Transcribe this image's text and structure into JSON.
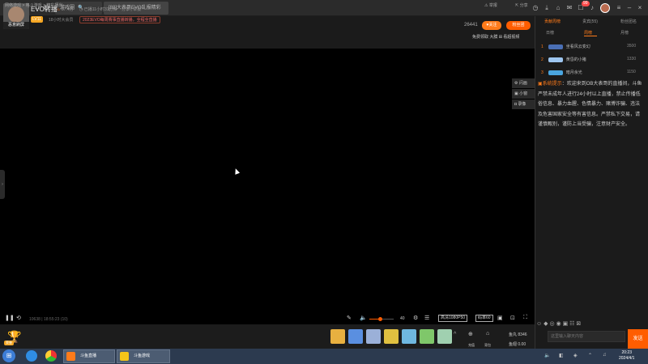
{
  "browser": {
    "logo": "斗鱼",
    "back": "←",
    "refresh": "C",
    "tabs": [
      {
        "label": "游戏圈",
        "close": ""
      },
      {
        "label": "[88]大表哥EVO乱报精彩",
        "close": "×"
      }
    ],
    "tab_search": "🔍"
  },
  "topbar_icons": [
    "clock-icon",
    "download-icon",
    "gift-icon",
    "mail-icon",
    "message-icon",
    "notification-icon",
    "menu-icon"
  ],
  "notifications": "99",
  "room": {
    "title": "EVO转播",
    "hot": "57.4万",
    "schedule": "已播11小时31分钟",
    "report": "分享 | 举报",
    "level": "LV11",
    "rank": "18小时大会员",
    "promo": "2023EVO每周赛事直播转播，全程全直播",
    "followers": "26441",
    "follow_label": "关注",
    "fan_label": "粉丝团",
    "sub_links": "免费领取  大膜  ⊞ 看超视频"
  },
  "anchor_caption": "恶意刷屏",
  "breadcrumb": "网络游戏 > 格斗游戏 > 精彩播出",
  "report_label": "举报",
  "share_label": "分享",
  "float_tools": [
    "闪画",
    "小窗",
    "录像"
  ],
  "controls": {
    "resolution": "高清1080P50",
    "bitrate": "码率60",
    "volume": "40",
    "volume_level": 0.43,
    "status": "10638 | 18:55:23 (10)"
  },
  "gifts": [
    {
      "color": "#e8b040",
      "label": ""
    },
    {
      "color": "#5a8fe0",
      "label": ""
    },
    {
      "color": "#9bb0d8",
      "label": ""
    },
    {
      "color": "#e0c040",
      "label": ""
    },
    {
      "color": "#6fb8e0",
      "label": ""
    },
    {
      "color": "#7fc76a",
      "label": ""
    },
    {
      "color": "#a0d0b0",
      "label": ""
    }
  ],
  "gift_side": [
    {
      "label": "充值"
    },
    {
      "label": "背包"
    }
  ],
  "balance": [
    "鱼丸 8346",
    "鱼翅 0.00"
  ],
  "trophy_label": "荣誉",
  "sidebar": {
    "tabs": [
      "贡献周榜",
      "贵宾(55)",
      "粉丝团名"
    ],
    "subtabs": [
      "日榜",
      "周榜",
      "月榜"
    ],
    "ranks": [
      {
        "num": "1",
        "name": "坐看风云变幻",
        "value": "3500",
        "color": "#4a6fb5"
      },
      {
        "num": "2",
        "name": "黄昏的小猪",
        "value": "1330",
        "color": "#9ec6f0"
      },
      {
        "num": "3",
        "name": "暗月余光",
        "value": "1150",
        "color": "#4aa6e0"
      }
    ],
    "notice_head": "系统提示",
    "notice": "：欢迎来到OB大表哥的直播间，斗鱼严禁未成年人进行24小时以上直播，禁止传播低俗信息、暴力血腥、色情暴力、赌博诈骗、违法及危害国家安全等有害信息。严禁私下交易，请谨慎甄别，谨防上当受骗，注意财产安全。",
    "chat_placeholder": "这里输入聊天内容",
    "send": "发送"
  },
  "taskbar": {
    "apps": [
      {
        "label": "斗鱼直播",
        "color": "#ff7b1a"
      },
      {
        "label": "斗鱼游戏",
        "color": "#f5c518"
      }
    ],
    "time": "20:23",
    "date": "2024/4/1"
  }
}
